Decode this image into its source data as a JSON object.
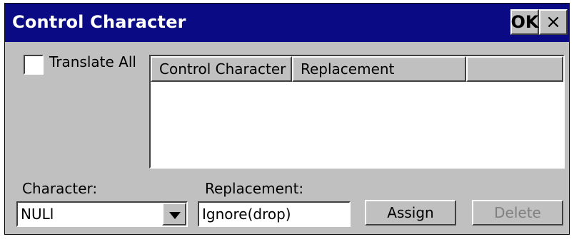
{
  "window": {
    "title": "Control Character",
    "ok_label": "OK",
    "close_label": "×"
  },
  "translate_all": {
    "label": "Translate All",
    "checked": false
  },
  "table": {
    "columns": [
      "Control Character",
      "Replacement",
      ""
    ],
    "rows": []
  },
  "character": {
    "label": "Character:",
    "value": "NULl"
  },
  "replacement": {
    "label": "Replacement:",
    "value": "Ignore(drop)"
  },
  "buttons": {
    "assign": "Assign",
    "delete": "Delete"
  }
}
